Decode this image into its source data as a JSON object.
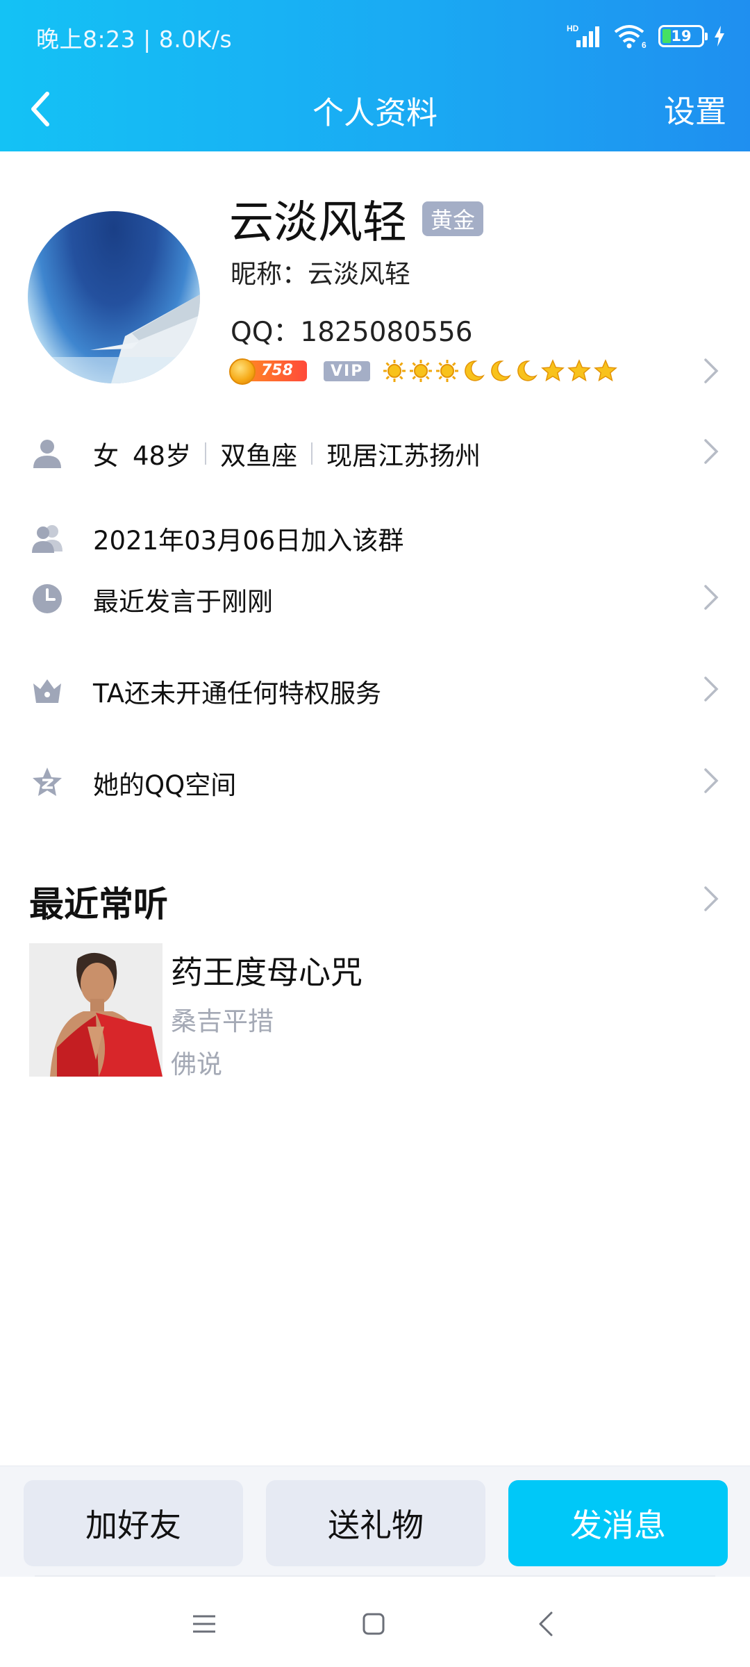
{
  "status_bar": {
    "time_speed": "晚上8:23 | 8.0K/s",
    "network": "HD",
    "wifi": "6",
    "battery": "19"
  },
  "nav": {
    "title": "个人资料",
    "settings_label": "设置"
  },
  "profile": {
    "name": "云淡风轻",
    "tier": "黄金",
    "nickname": "昵称：云淡风轻",
    "qq": "QQ：1825080556",
    "coin_value": "758",
    "vip_label": "VIP",
    "level_icons": [
      "sun-icon",
      "sun-icon",
      "sun-icon",
      "moon-icon",
      "moon-icon",
      "moon-icon",
      "star-icon",
      "star-icon",
      "star-icon"
    ]
  },
  "details": {
    "gender": "女",
    "age": "48岁",
    "constellation": "双鱼座",
    "location": "现居江苏扬州",
    "joined": "2021年03月06日加入该群",
    "last_spoke": "最近发言于刚刚",
    "privilege": "TA还未开通任何特权服务",
    "qzone": "她的QQ空间"
  },
  "recent_listening": {
    "title": "最近常听",
    "song": {
      "title": "药王度母心咒",
      "artist": "桑吉平措",
      "album": "佛说"
    }
  },
  "actions": {
    "add_friend": "加好友",
    "send_gift": "送礼物",
    "send_message": "发消息"
  },
  "colors": {
    "header_start": "#14c2f5",
    "header_end": "#1f8ff0",
    "primary_button": "#00c8f8",
    "secondary_button": "#e6eaf3",
    "badge_gray": "#a4aec6",
    "muted_text": "#a4a9b5"
  }
}
